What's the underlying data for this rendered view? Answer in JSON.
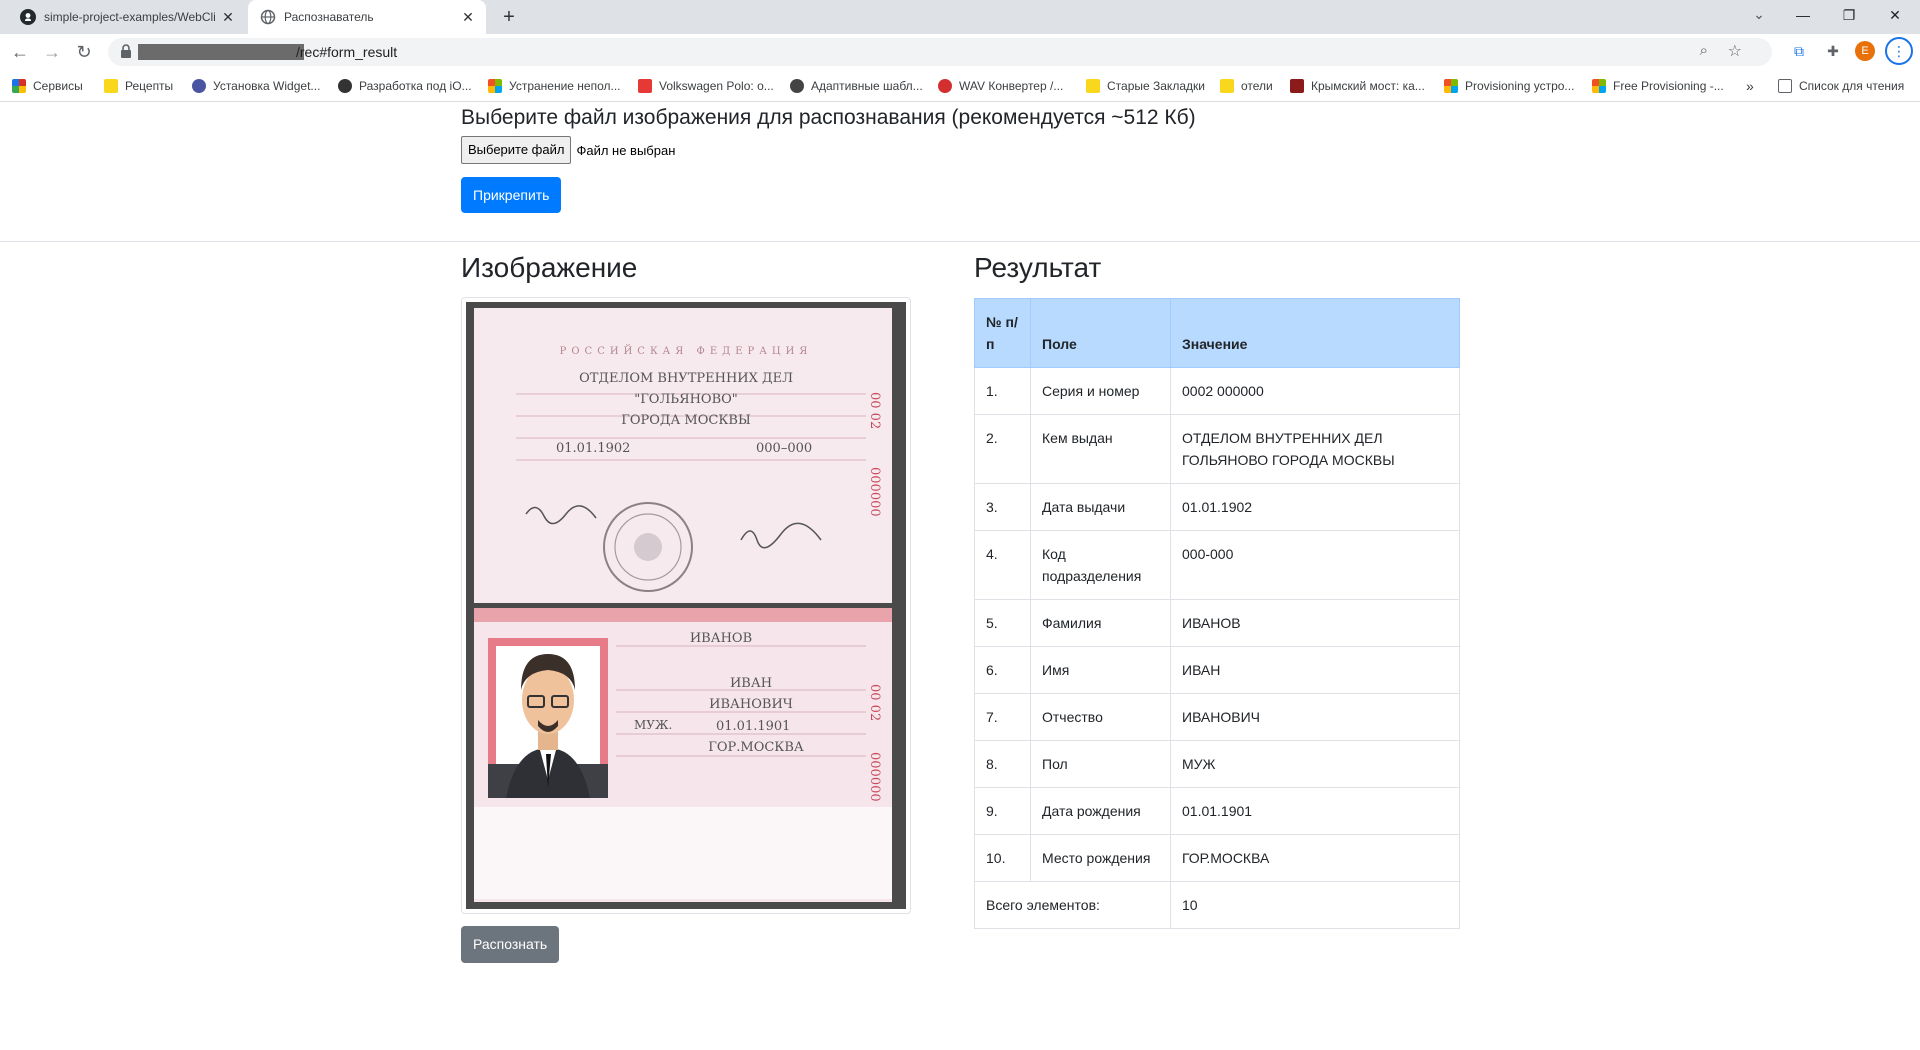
{
  "tabs": [
    {
      "title": "simple-project-examples/WebCli",
      "active": false
    },
    {
      "title": "Распознаватель",
      "active": true
    }
  ],
  "address": {
    "url_suffix": "/rec#form_result"
  },
  "bookmarks": [
    {
      "label": "Сервисы",
      "icon": "apps-grid-icon",
      "color": "#d93025"
    },
    {
      "label": "Рецепты",
      "icon": "folder-icon",
      "color": "#f9d71c"
    },
    {
      "label": "Установка Widget...",
      "icon": "site-icon",
      "color": "#4a55a2"
    },
    {
      "label": "Разработка под iO...",
      "icon": "site-icon",
      "color": "#333333"
    },
    {
      "label": "Устранение непол...",
      "icon": "microsoft-icon",
      "color": "#f25022"
    },
    {
      "label": "Volkswagen Polo: o...",
      "icon": "site-icon",
      "color": "#e53935"
    },
    {
      "label": "Адаптивные шабл...",
      "icon": "site-icon",
      "color": "#444444"
    },
    {
      "label": "WAV Конвертер /...",
      "icon": "site-icon",
      "color": "#d32f2f"
    },
    {
      "label": "Старые Закладки",
      "icon": "folder-icon",
      "color": "#f9d71c"
    },
    {
      "label": "отели",
      "icon": "folder-icon",
      "color": "#f9d71c"
    },
    {
      "label": "Крымский мост: ка...",
      "icon": "site-icon",
      "color": "#8b1a1a"
    },
    {
      "label": "Provisioning устро...",
      "icon": "microsoft-icon",
      "color": "#f25022"
    },
    {
      "label": "Free Provisioning -...",
      "icon": "microsoft-icon",
      "color": "#f25022"
    }
  ],
  "bookmarks_more": "»",
  "reading_list": "Список для чтения",
  "avatar_letter": "E",
  "upload": {
    "heading": "Выберите файл изображения для распознавания (рекомендуется ~512 Кб)",
    "choose_button": "Выберите файл",
    "no_file_text": "Файл не выбран",
    "attach_button": "Прикрепить"
  },
  "image_section": {
    "title": "Изображение"
  },
  "passport": {
    "country": "РОССИЙСКАЯ ФЕДЕРАЦИЯ",
    "issuer_line1": "ОТДЕЛОМ ВНУТРЕННИХ ДЕЛ",
    "issuer_line2": "\"ГОЛЬЯНОВО\"",
    "issuer_line3": "ГОРОДА МОСКВЫ",
    "issue_date": "01.01.1902",
    "dept_code": "000–000",
    "series_top": "00 02",
    "number": "000000",
    "surname": "ИВАНОВ",
    "name": "ИВАН",
    "patronymic": "ИВАНОВИЧ",
    "sex": "МУЖ.",
    "birth_date": "01.01.1901",
    "birth_place": "ГОР.МОСКВА"
  },
  "recognize_button": "Распознать",
  "result_section": {
    "title": "Результат",
    "headers": [
      "№ п/п",
      "Поле",
      "Значение"
    ],
    "rows": [
      {
        "n": "1.",
        "field": "Серия и номер",
        "value": "0002 000000"
      },
      {
        "n": "2.",
        "field": "Кем выдан",
        "value": "ОТДЕЛОМ ВНУТРЕННИХ ДЕЛ ГОЛЬЯНОВО ГОРОДА МОСКВЫ"
      },
      {
        "n": "3.",
        "field": "Дата выдачи",
        "value": "01.01.1902"
      },
      {
        "n": "4.",
        "field": "Код подразделения",
        "value": "000-000"
      },
      {
        "n": "5.",
        "field": "Фамилия",
        "value": "ИВАНОВ"
      },
      {
        "n": "6.",
        "field": "Имя",
        "value": "ИВАН"
      },
      {
        "n": "7.",
        "field": "Отчество",
        "value": "ИВАНОВИЧ"
      },
      {
        "n": "8.",
        "field": "Пол",
        "value": "МУЖ"
      },
      {
        "n": "9.",
        "field": "Дата рождения",
        "value": "01.01.1901"
      },
      {
        "n": "10.",
        "field": "Место рождения",
        "value": "ГОР.МОСКВА"
      }
    ],
    "total_label": "Всего элементов:",
    "total_value": "10"
  }
}
